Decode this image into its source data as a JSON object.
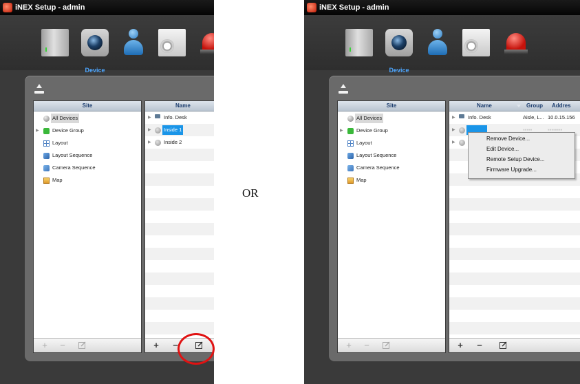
{
  "left": {
    "title": "iNEX Setup - admin",
    "toolbar": {
      "active_label": "Device",
      "items": [
        "server-icon",
        "camera-icon",
        "user-icon",
        "schedule-icon",
        "alarm-icon"
      ]
    },
    "site_pane": {
      "header": "Site",
      "items": [
        {
          "label": "All Devices",
          "icon": "globe-icon",
          "selected": true
        },
        {
          "label": "Device Group",
          "icon": "group-icon",
          "expandable": true
        },
        {
          "label": "Layout",
          "icon": "layout-icon"
        },
        {
          "label": "Layout Sequence",
          "icon": "layout-sequence-icon"
        },
        {
          "label": "Camera Sequence",
          "icon": "camera-sequence-icon"
        },
        {
          "label": "Map",
          "icon": "map-icon"
        }
      ],
      "footer": {
        "add": "+",
        "remove": "−"
      }
    },
    "name_pane": {
      "header": "Name",
      "rows": [
        {
          "name": "Info. Desk",
          "icon": "monitor-icon"
        },
        {
          "name": "Inside 1",
          "icon": "camera-device-icon",
          "selected": true
        },
        {
          "name": "Inside 2",
          "icon": "camera-device-icon"
        }
      ],
      "footer": {
        "add": "+",
        "remove": "−"
      }
    }
  },
  "separator": "OR",
  "right": {
    "title": "iNEX Setup - admin",
    "toolbar": {
      "active_label": "Device",
      "items": [
        "server-icon",
        "camera-icon",
        "user-icon",
        "schedule-icon",
        "alarm-icon"
      ]
    },
    "site_pane": {
      "header": "Site",
      "items": [
        {
          "label": "All Devices",
          "icon": "globe-icon",
          "selected": true
        },
        {
          "label": "Device Group",
          "icon": "group-icon",
          "expandable": true
        },
        {
          "label": "Layout",
          "icon": "layout-icon"
        },
        {
          "label": "Layout Sequence",
          "icon": "layout-sequence-icon"
        },
        {
          "label": "Camera Sequence",
          "icon": "camera-sequence-icon"
        },
        {
          "label": "Map",
          "icon": "map-icon"
        }
      ],
      "footer": {
        "add": "+",
        "remove": "−"
      }
    },
    "name_pane": {
      "headers": {
        "name": "Name",
        "group": "Group",
        "address": "Addres"
      },
      "rows": [
        {
          "name": "Info. Desk",
          "group": "Aisle, L...",
          "address": "10.0.15.156",
          "icon": "monitor-icon"
        }
      ],
      "footer": {
        "add": "+",
        "remove": "−"
      }
    },
    "context_menu": {
      "items": [
        "Remove Device...",
        "Edit Device...",
        "Remote Setup Device...",
        "Firmware Upgrade..."
      ]
    }
  },
  "colors": {
    "accent": "#1a95e8",
    "highlight_circle": "#e01212",
    "window_bg": "#3a3a3a"
  }
}
